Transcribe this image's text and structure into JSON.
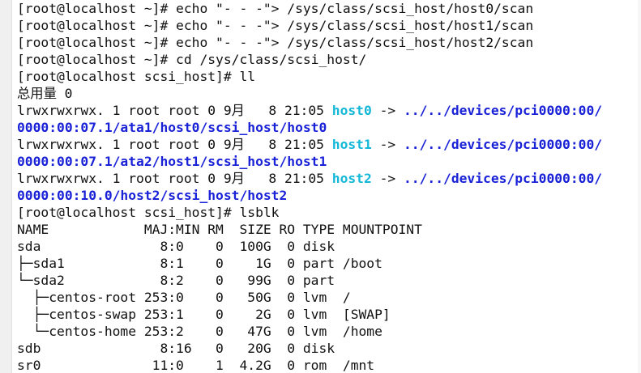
{
  "terminal": {
    "lines": [
      {
        "segments": [
          {
            "text": "[root@localhost ~]# echo \"- - -\"> /sys/class/scsi_host/host0/scan",
            "style": "plain"
          }
        ]
      },
      {
        "segments": [
          {
            "text": "[root@localhost ~]# echo \"- - -\"> /sys/class/scsi_host/host1/scan",
            "style": "plain"
          }
        ]
      },
      {
        "segments": [
          {
            "text": "[root@localhost ~]# echo \"- - -\"> /sys/class/scsi_host/host2/scan",
            "style": "plain"
          }
        ]
      },
      {
        "segments": [
          {
            "text": "[root@localhost ~]# cd /sys/class/scsi_host/",
            "style": "plain"
          }
        ]
      },
      {
        "segments": [
          {
            "text": "[root@localhost scsi_host]# ll",
            "style": "plain"
          }
        ]
      },
      {
        "segments": [
          {
            "text": "总用量 0",
            "style": "plain"
          }
        ]
      },
      {
        "segments": [
          {
            "text": "lrwxrwxrwx. 1 root root 0 9月   8 21:05 ",
            "style": "plain"
          },
          {
            "text": "host0",
            "style": "cyan"
          },
          {
            "text": " -> ",
            "style": "plain"
          },
          {
            "text": "../../devices/pci0000:00/",
            "style": "blue"
          }
        ]
      },
      {
        "segments": [
          {
            "text": "0000:00:07.1/ata1/host0/scsi_host/host0",
            "style": "blue"
          }
        ]
      },
      {
        "segments": [
          {
            "text": "lrwxrwxrwx. 1 root root 0 9月   8 21:05 ",
            "style": "plain"
          },
          {
            "text": "host1",
            "style": "cyan"
          },
          {
            "text": " -> ",
            "style": "plain"
          },
          {
            "text": "../../devices/pci0000:00/",
            "style": "blue"
          }
        ]
      },
      {
        "segments": [
          {
            "text": "0000:00:07.1/ata2/host1/scsi_host/host1",
            "style": "blue"
          }
        ]
      },
      {
        "segments": [
          {
            "text": "lrwxrwxrwx. 1 root root 0 9月   8 21:05 ",
            "style": "plain"
          },
          {
            "text": "host2",
            "style": "cyan"
          },
          {
            "text": " -> ",
            "style": "plain"
          },
          {
            "text": "../../devices/pci0000:00/",
            "style": "blue"
          }
        ]
      },
      {
        "segments": [
          {
            "text": "0000:00:10.0/host2/scsi_host/host2",
            "style": "blue"
          }
        ]
      },
      {
        "segments": [
          {
            "text": "[root@localhost scsi_host]# lsblk",
            "style": "plain"
          }
        ]
      },
      {
        "segments": [
          {
            "text": "NAME            MAJ:MIN RM  SIZE RO TYPE MOUNTPOINT",
            "style": "plain"
          }
        ]
      },
      {
        "segments": [
          {
            "text": "sda               8:0    0  100G  0 disk",
            "style": "plain"
          }
        ]
      },
      {
        "segments": [
          {
            "text": "├─sda1            8:1    0    1G  0 part /boot",
            "style": "plain"
          }
        ]
      },
      {
        "segments": [
          {
            "text": "└─sda2            8:2    0   99G  0 part",
            "style": "plain"
          }
        ]
      },
      {
        "segments": [
          {
            "text": "  ├─centos-root 253:0    0   50G  0 lvm  /",
            "style": "plain"
          }
        ]
      },
      {
        "segments": [
          {
            "text": "  ├─centos-swap 253:1    0    2G  0 lvm  [SWAP]",
            "style": "plain"
          }
        ]
      },
      {
        "segments": [
          {
            "text": "  └─centos-home 253:2    0   47G  0 lvm  /home",
            "style": "plain"
          }
        ]
      },
      {
        "segments": [
          {
            "text": "sdb               8:16   0   20G  0 disk",
            "style": "plain"
          }
        ]
      },
      {
        "segments": [
          {
            "text": "sr0              11:0    1  4.2G  0 rom  /mnt",
            "style": "plain"
          }
        ]
      }
    ]
  },
  "colors": {
    "background": "#ffffff",
    "text": "#111111",
    "symlink_name": "#13b8d8",
    "symlink_target": "#1a22d8"
  }
}
